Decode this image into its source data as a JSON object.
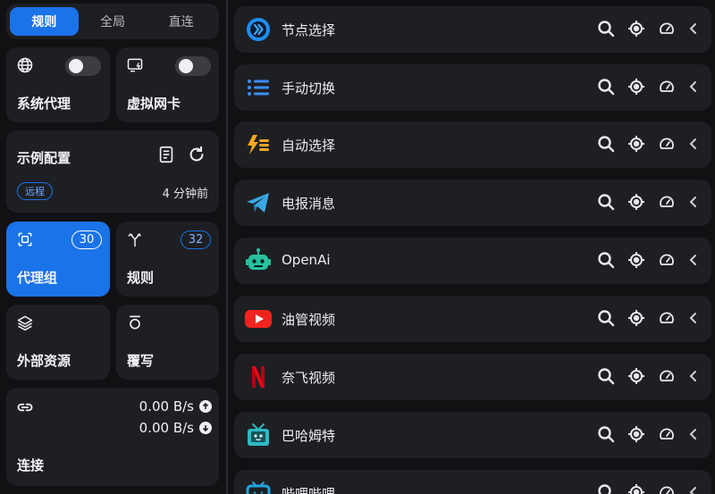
{
  "mode_switch": {
    "tabs": [
      "规则",
      "全局",
      "直连"
    ],
    "active": 0
  },
  "system_proxy": {
    "label": "系统代理",
    "enabled": false
  },
  "tun_mode": {
    "label": "虚拟网卡",
    "enabled": false
  },
  "profile": {
    "name": "示例配置",
    "type_badge": "远程",
    "updated": "4 分钟前"
  },
  "proxy_groups_card": {
    "label": "代理组",
    "count": "30"
  },
  "rules_card": {
    "label": "规则",
    "count": "32"
  },
  "resources_card": {
    "label": "外部资源"
  },
  "override_card": {
    "label": "覆写"
  },
  "connections": {
    "label": "连接",
    "upload": "0.00 B/s",
    "download": "0.00 B/s"
  },
  "groups": [
    {
      "name": "节点选择",
      "icon": "node-select-icon"
    },
    {
      "name": "手动切换",
      "icon": "list-icon"
    },
    {
      "name": "自动选择",
      "icon": "lightning-icon"
    },
    {
      "name": "电报消息",
      "icon": "telegram-icon"
    },
    {
      "name": "OpenAi",
      "icon": "robot-icon"
    },
    {
      "name": "油管视频",
      "icon": "youtube-icon"
    },
    {
      "name": "奈飞视频",
      "icon": "netflix-icon"
    },
    {
      "name": "巴哈姆特",
      "icon": "bahamut-icon"
    },
    {
      "name": "哔哩哔哩",
      "icon": "bilibili-icon"
    }
  ],
  "colors": {
    "accent": "#1a73e8",
    "card": "#1e1f23",
    "background": "#111113"
  }
}
